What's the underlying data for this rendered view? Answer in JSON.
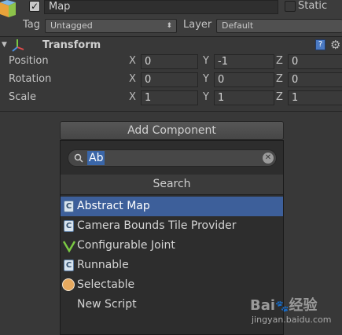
{
  "object": {
    "name": "Map",
    "static_label": "Static",
    "tag_label": "Tag",
    "tag_value": "Untagged",
    "layer_label": "Layer",
    "layer_value": "Default"
  },
  "transform": {
    "title": "Transform",
    "rows": [
      {
        "label": "Position",
        "x": "0",
        "y": "-1",
        "z": "0"
      },
      {
        "label": "Rotation",
        "x": "0",
        "y": "0",
        "z": "0"
      },
      {
        "label": "Scale",
        "x": "1",
        "y": "1",
        "z": "1"
      }
    ],
    "axes": [
      "X",
      "Y",
      "Z"
    ]
  },
  "add_component": {
    "button_label": "Add Component",
    "search_value": "Ab",
    "section_title": "Search",
    "items": [
      {
        "label": "Abstract Map",
        "icon": "csharp-script-icon"
      },
      {
        "label": "Camera Bounds Tile Provider",
        "icon": "csharp-script-icon"
      },
      {
        "label": "Configurable Joint",
        "icon": "joint-icon"
      },
      {
        "label": "Runnable",
        "icon": "csharp-script-icon"
      },
      {
        "label": "Selectable",
        "icon": "selectable-icon"
      },
      {
        "label": "New Script",
        "icon": ""
      }
    ]
  },
  "watermark": {
    "brand_a": "Bai",
    "brand_b": "经验",
    "url": "jingyan.baidu.com"
  },
  "colors": {
    "background": "#383838",
    "selection": "#3d5f9a"
  }
}
